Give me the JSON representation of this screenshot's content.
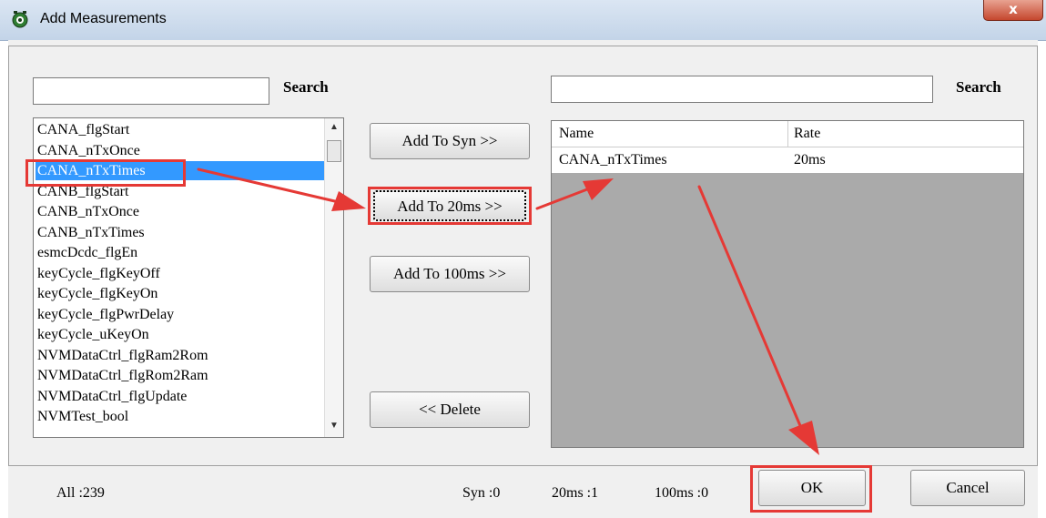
{
  "window": {
    "title": "Add Measurements",
    "close_glyph": "x"
  },
  "left_panel": {
    "search_value": "",
    "search_label": "Search",
    "items": [
      "CANA_flgStart",
      "CANA_nTxOnce",
      "CANA_nTxTimes",
      "CANB_flgStart",
      "CANB_nTxOnce",
      "CANB_nTxTimes",
      "esmcDcdc_flgEn",
      "keyCycle_flgKeyOff",
      "keyCycle_flgKeyOn",
      "keyCycle_flgPwrDelay",
      "keyCycle_uKeyOn",
      "NVMDataCtrl_flgRam2Rom",
      "NVMDataCtrl_flgRom2Ram",
      "NVMDataCtrl_flgUpdate",
      "NVMTest_bool"
    ],
    "selected_index": 2
  },
  "buttons": {
    "add_syn": "Add To Syn >>",
    "add_20ms": "Add To 20ms >>",
    "add_100ms": "Add To 100ms >>",
    "delete": "<< Delete",
    "ok": "OK",
    "cancel": "Cancel"
  },
  "right_panel": {
    "search_value": "",
    "search_label": "Search",
    "columns": [
      "Name",
      "Rate"
    ],
    "rows": [
      {
        "name": "CANA_nTxTimes",
        "rate": "20ms"
      }
    ]
  },
  "status": {
    "all": "All :239",
    "syn": "Syn :0",
    "ms20": "20ms :1",
    "ms100": "100ms :0"
  },
  "colors": {
    "selection": "#3399ff",
    "annotation": "#e53935",
    "grid_bg": "#aaaaaa"
  }
}
